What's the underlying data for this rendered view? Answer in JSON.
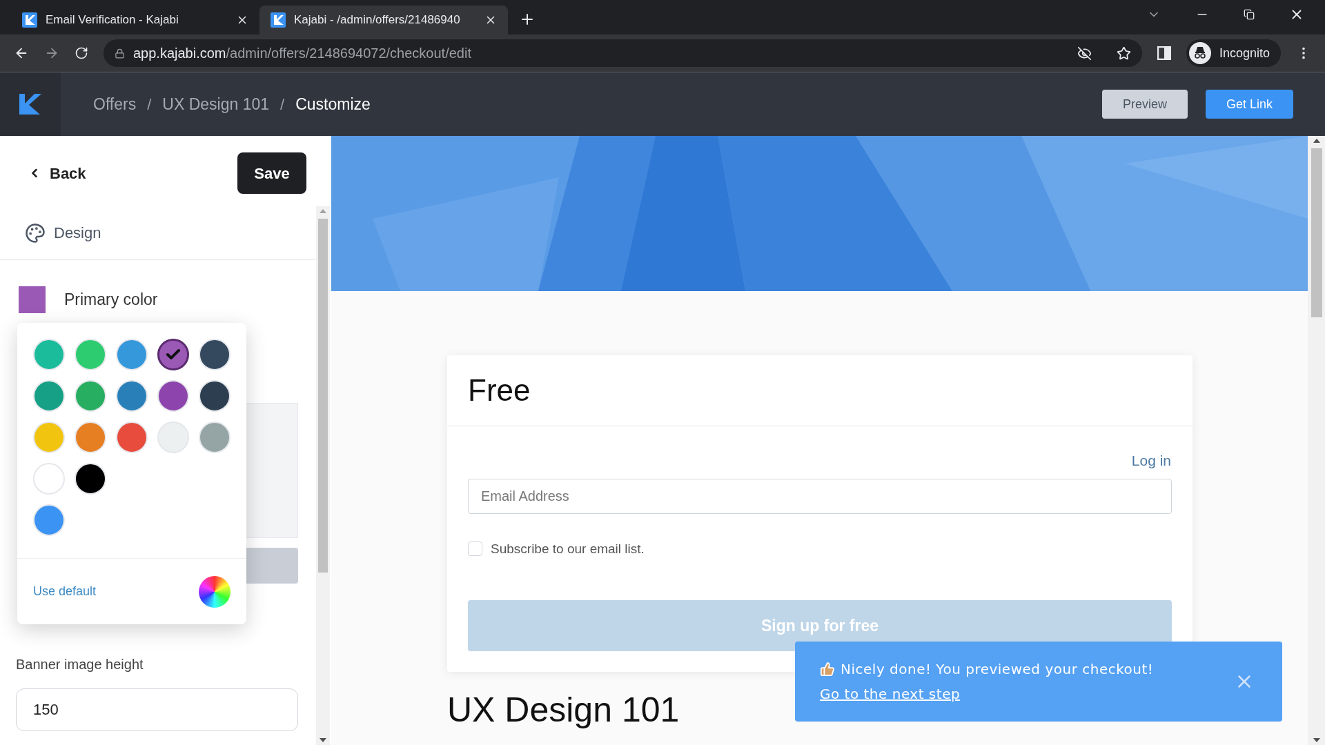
{
  "browser": {
    "tabs": [
      {
        "title": "Email Verification - Kajabi",
        "selected": false
      },
      {
        "title": "Kajabi - /admin/offers/21486940",
        "selected": true
      }
    ],
    "url_host": "app.kajabi.com",
    "url_path": "/admin/offers/2148694072/checkout/edit",
    "profile": "Incognito"
  },
  "header": {
    "breadcrumbs": [
      {
        "label": "Offers",
        "current": false
      },
      {
        "label": "UX Design 101",
        "current": false
      },
      {
        "label": "Customize",
        "current": true
      }
    ],
    "separator": "/",
    "buttons": [
      {
        "label": "Preview",
        "kind": "secondary"
      },
      {
        "label": "Get Link",
        "kind": "primary"
      }
    ]
  },
  "sidebar": {
    "back": "Back",
    "save": "Save",
    "section": "Design",
    "primary_color_label": "Primary color",
    "swatches": [
      {
        "color": "#1abc9c",
        "selected": false
      },
      {
        "color": "#2ecc71",
        "selected": false
      },
      {
        "color": "#3498db",
        "selected": false
      },
      {
        "color": "#9b59b6",
        "selected": true
      },
      {
        "color": "#34495e",
        "selected": false
      },
      {
        "color": "#16a085",
        "selected": false
      },
      {
        "color": "#27ae60",
        "selected": false
      },
      {
        "color": "#2980b9",
        "selected": false
      },
      {
        "color": "#8e44ad",
        "selected": false
      },
      {
        "color": "#2c3e50",
        "selected": false
      },
      {
        "color": "#f1c40f",
        "selected": false
      },
      {
        "color": "#e67e22",
        "selected": false
      },
      {
        "color": "#e74c3c",
        "selected": false
      },
      {
        "color": "#ecf0f1",
        "selected": false
      },
      {
        "color": "#95a5a6",
        "selected": false
      },
      {
        "color": "#ffffff",
        "selected": false
      },
      {
        "color": "#000000",
        "selected": false
      },
      {
        "color": "#3b93f3",
        "selected": false
      }
    ],
    "use_default": "Use default",
    "banner_height_label": "Banner image height",
    "banner_height_value": "150"
  },
  "checkout": {
    "title": "Free",
    "login": "Log in",
    "email_placeholder": "Email Address",
    "subscribe_label": "Subscribe to our email list.",
    "subscribe_checked": false,
    "submit": "Sign up for free",
    "heading": "UX Design 101"
  },
  "toast": {
    "message": "Nicely done! You previewed your checkout!",
    "link": "Go to the next step"
  }
}
